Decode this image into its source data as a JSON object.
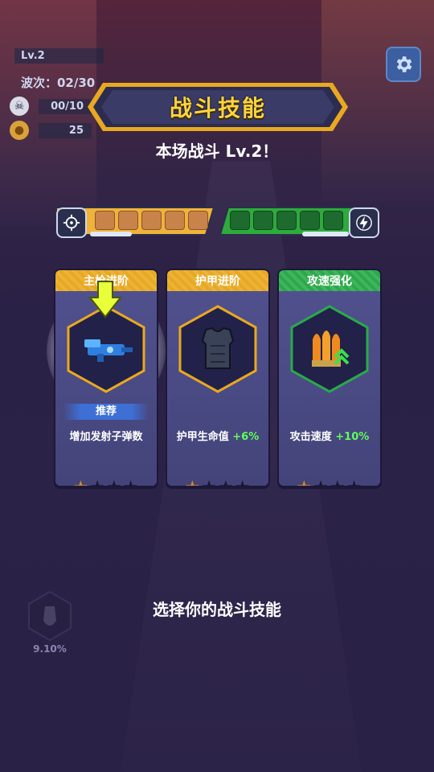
{
  "hud": {
    "level": "Lv.2",
    "wave": "波次：02/30",
    "kills": "00/10",
    "coins": "25"
  },
  "banner": {
    "title": "战斗技能",
    "subtitle": "本场战斗 Lv.2！"
  },
  "progress": {
    "left_filled": 5,
    "right_filled": 5
  },
  "cards": [
    {
      "category": "主枪进阶",
      "badge": "推荐",
      "desc": "增加发射子弹数",
      "bonus": "",
      "stars_filled": 1,
      "stars_total": 4,
      "header_color": "#e8a920"
    },
    {
      "category": "护甲进阶",
      "badge": "",
      "desc": "护甲生命值 ",
      "bonus": "+6%",
      "stars_filled": 1,
      "stars_total": 4,
      "header_color": "#e8a920"
    },
    {
      "category": "攻速强化",
      "badge": "",
      "desc": "攻击速度 ",
      "bonus": "+10%",
      "stars_filled": 1,
      "stars_total": 4,
      "header_color": "#2aa94a"
    }
  ],
  "prompt": "选择你的战斗技能",
  "skill_slot": {
    "percent": "9.10%"
  }
}
